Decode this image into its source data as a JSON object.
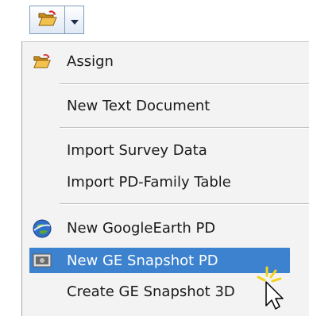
{
  "toolbar": {
    "open_icon": "open-folder-icon",
    "dropdown_icon": "chevron-down-icon"
  },
  "menu": {
    "items": [
      {
        "label": "Assign",
        "icon": "open-folder-icon"
      },
      {
        "label": "New Text Document"
      },
      {
        "label": "Import Survey Data"
      },
      {
        "label": "Import PD-Family Table"
      },
      {
        "label": "New GoogleEarth PD",
        "icon": "google-earth-icon"
      },
      {
        "label": "New GE Snapshot PD",
        "icon": "snapshot-icon",
        "highlighted": true
      },
      {
        "label": "Create GE Snapshot 3D"
      }
    ]
  },
  "colors": {
    "menu_background": "#f3f3f3",
    "highlight": "#3d82ce",
    "highlight_text": "#ffffff"
  }
}
